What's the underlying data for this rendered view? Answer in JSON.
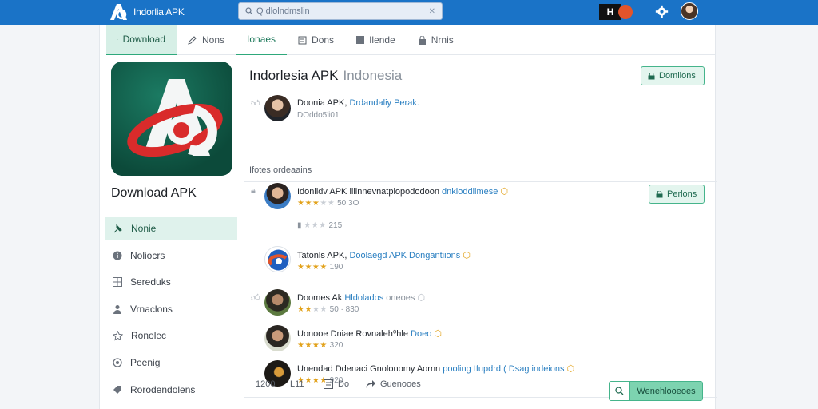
{
  "topbar": {
    "brand": "Indorlia APK",
    "search_value": "Q dlolndmslin",
    "badge_text": "H"
  },
  "tabs": [
    {
      "label": "Download",
      "icon": "download-icon"
    },
    {
      "label": "Nons",
      "icon": "edit-icon"
    },
    {
      "label": "Ionaes",
      "icon": "none"
    },
    {
      "label": "Dons",
      "icon": "doc-icon"
    },
    {
      "label": "Ilende",
      "icon": "square-icon"
    },
    {
      "label": "Nrnis",
      "icon": "lock-icon"
    }
  ],
  "app": {
    "title": "Download APK",
    "icon_bg": "#0f5a47"
  },
  "sidebar": {
    "items": [
      {
        "label": "Nonie",
        "icon": "pin-icon"
      },
      {
        "label": "Noliocrs",
        "icon": "info-icon"
      },
      {
        "label": "Sereduks",
        "icon": "grid-icon"
      },
      {
        "label": "Vrnaclons",
        "icon": "user-icon"
      },
      {
        "label": "Ronolec",
        "icon": "star-icon"
      },
      {
        "label": "Peenig",
        "icon": "circle-icon"
      },
      {
        "label": "Rorodendolens",
        "icon": "tag-icon"
      }
    ]
  },
  "main": {
    "title": "Indorlesia APK",
    "title_sub": "Indonesia",
    "top_button": "Domiions",
    "author": {
      "name": "Doonia APK,",
      "link": "Drdandaliy",
      "link2": "Perak.",
      "meta": "DOddo5'i01"
    },
    "section_label": "Ifotes ordeaains",
    "side_button": "Perlons",
    "reviews": [
      {
        "name": "Idonlidv APK",
        "text": "lliinnevnatplopododoon",
        "link": "dnkloddlimese",
        "stars": 3,
        "meta": "50 3O"
      },
      {
        "name": "Tatonls APK,",
        "text": "",
        "link": "Doolaegd APK Dongantiions",
        "stars": 4,
        "meta": "190"
      },
      {
        "name": "Doomes Ak",
        "text": "",
        "link": "Hldolados",
        "after": "oneoes",
        "stars": 2.5,
        "meta": "50 · 830"
      },
      {
        "name": "Uonooe Dniae Rovnaleh⁰hle",
        "text": "",
        "link": "Doeo",
        "stars": 4,
        "meta": "320"
      },
      {
        "name": "Unendad Ddenaci Gnolonomy Aornn",
        "text": "",
        "link": "pooling Ifupdrd ( Dsag indeions",
        "stars": 4,
        "meta": "920"
      }
    ],
    "vote_meta": "215",
    "footer": [
      {
        "label": "1200",
        "icon": "none"
      },
      {
        "label": "L11",
        "icon": "none"
      },
      {
        "label": "Do",
        "icon": "comment-icon"
      },
      {
        "label": "Guenooes",
        "icon": "share-icon"
      }
    ],
    "footer_button": "Wenehlooeoes"
  }
}
